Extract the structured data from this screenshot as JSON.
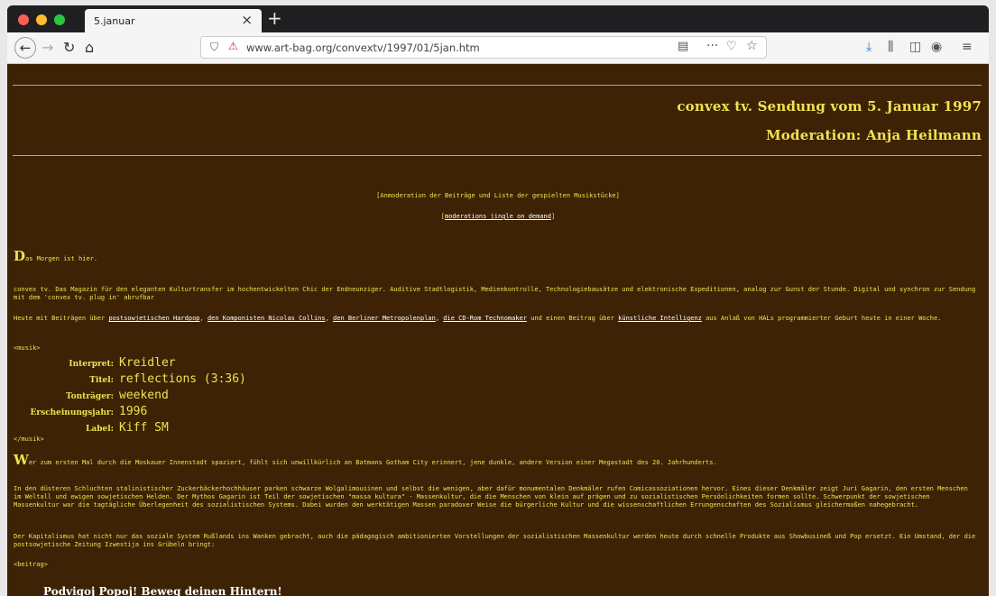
{
  "browser": {
    "tab_title": "5.januar",
    "url": "www.art-bag.org/convextv/1997/01/5jan.htm",
    "colors": {
      "tabbar": "#1f1f22",
      "page_bg": "#3d2205",
      "text": "#f2e24f"
    }
  },
  "page": {
    "title": "convex tv. Sendung vom 5. Januar 1997",
    "subtitle": "Moderation: Anja Heilmann",
    "intro_link": "[Anmoderation der Beiträge und Liste der gespielten Musikstücke]",
    "jingle_prefix": "[",
    "jingle_link": "moderations jingle on demand",
    "jingle_suffix": "]",
    "p1_drop": "D",
    "p1_rest": "as Morgen ist hier.",
    "p2": "convex tv. Das Magazin für den eleganten Kulturtransfer im hochentwickelten Chic der Endneunziger. Auditive Stadtlogistik, Medienkontrolle, Technologiebausätze und elektronische Expeditionen, analog zur Gunst der Stunde. Digital und synchron zur Sendung mit dem 'convex tv. plug in' abrufbar",
    "p3_a": "Heute mit Beiträgen über ",
    "p3_link1": "postsowjetischen Hardpop",
    "p3_b": ", ",
    "p3_link2": "den Komponisten Nicolas Collins",
    "p3_c": ", ",
    "p3_link3": "den Berliner Metropolenplan",
    "p3_d": ", ",
    "p3_link4": "die CD-Rom Technomaker",
    "p3_e": " und einen Beitrag über ",
    "p3_link5": "künstliche Intelligenz",
    "p3_f": " aus Anlaß von HALs programmierter Geburt heute in einer Woche.",
    "musik_open": "<musik>",
    "musik_close": "</musik>",
    "music": [
      {
        "label": "Interpret:",
        "value": "Kreidler"
      },
      {
        "label": "Titel:",
        "value": "reflections (3:36)"
      },
      {
        "label": "Tonträger:",
        "value": "weekend"
      },
      {
        "label": "Erscheinungsjahr:",
        "value": "1996"
      },
      {
        "label": "Label:",
        "value": "Kiff SM"
      }
    ],
    "p4_drop": "W",
    "p4_rest": "er zum ersten Mal durch die Moskauer Innenstadt spaziert, fühlt sich unwillkürlich an Batmans Gotham City erinnert, jene dunkle, andere Version einer Megastadt des 20. Jahrhunderts.",
    "p5": "In den düsteren Schluchten stalinistischer Zuckerbäckerhochhäuser parken schwarze Wolgalimousinen und selbst die wenigen, aber dafür monumentalen Denkmäler rufen Comicassoziationen hervor. Eines dieser Denkmäler zeigt Juri Gagarin, den ersten Menschen im Weltall und ewigen sowjetischen Helden. Der Mythos Gagarin ist Teil der sowjetischen \"massa kultura\" - Massenkultur, die die Menschen von klein auf prägen und zu sozialistischen Persönlichkeiten formen sollte. Schwerpunkt der sowjetischen Massenkultur war die tagtägliche Überlegenheit des sozialistischen Systems. Dabei wurden den werktätigen Massen paradoxer Weise die bürgerliche Kultur und die wissenschaftlichen Errungenschaften des Sozialismus gleichermaßen nahegebracht.",
    "p6": "Der Kapitalismus hat nicht nur das soziale System Rußlands ins Wanken gebracht, auch die pädagogisch ambitionierten Vorstellungen der sozialistischen Massenkultur werden heute durch schnelle Produkte aus Showbusineß und Pop ersetzt. Ein Umstand, der die postsowjetische Zeitung Izwestija ins Grübeln bringt:",
    "beitrag_open": "<beitrag>",
    "headline": "Podvigoj Popoj! Beweg deinen Hintern!"
  }
}
